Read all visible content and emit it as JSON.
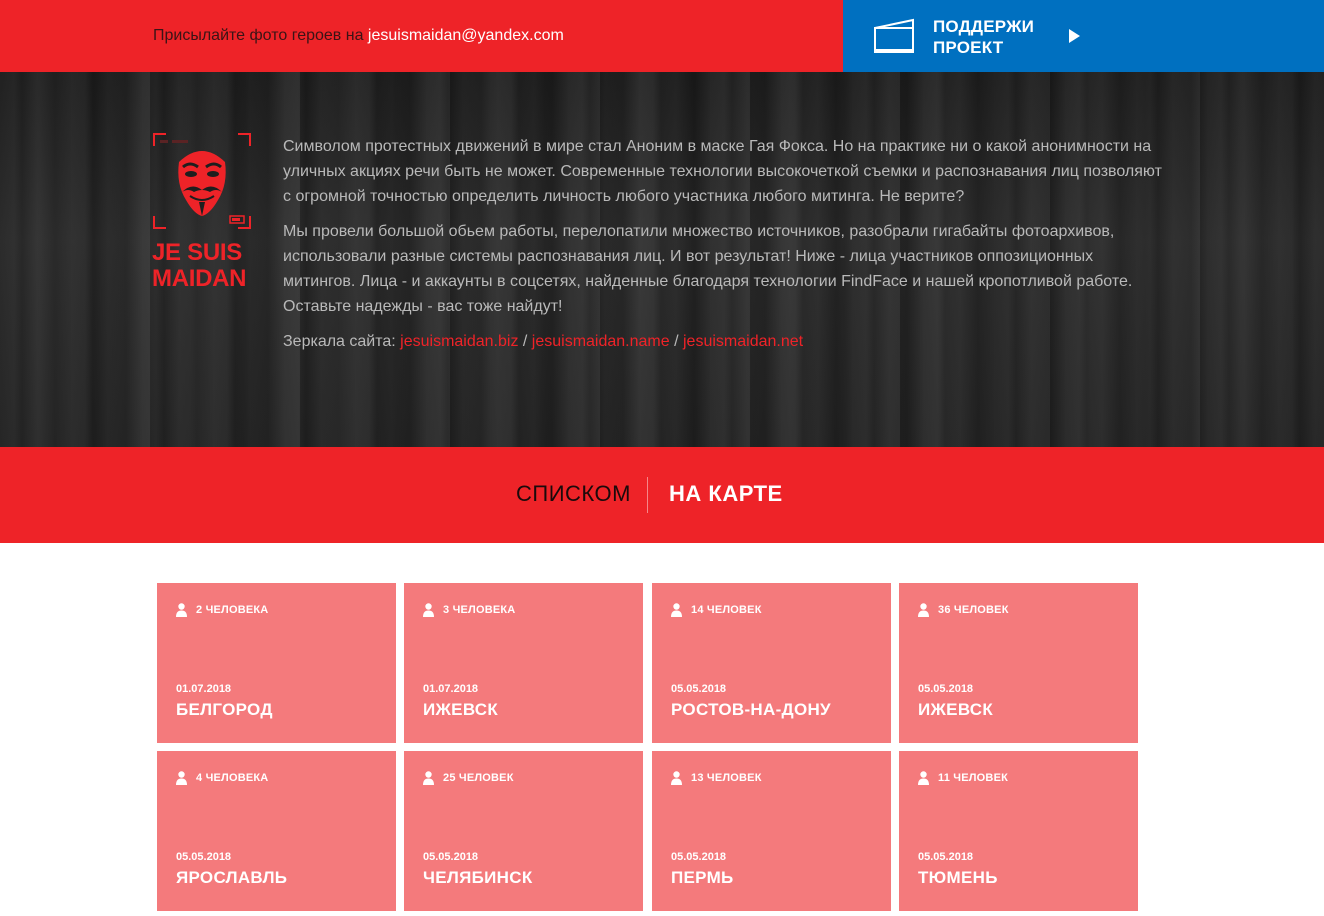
{
  "topbar": {
    "send_text": "Присылайте фото героев на ",
    "send_email": "jesuismaidan@yandex.com",
    "support_line1": "ПОДДЕРЖИ",
    "support_line2": "ПРОЕКТ"
  },
  "logo": {
    "line1": "JE SUIS",
    "line2": "MAIDAN"
  },
  "intro": {
    "paragraph1": "Символом протестных движений в мире стал Аноним в маске Гая Фокса. Но на практике ни о какой анонимности на уличных акциях речи быть не может. Современные технологии высокочеткой съемки и распознавания лиц позволяют с огромной точностью определить личность любого участника любого митинга. Не верите?",
    "paragraph2": "Мы провели большой обьем работы, перелопатили множество источников, разобрали гигабайты фотоархивов, использовали разные системы распознавания лиц. И вот результат! Ниже - лица участников оппозиционных митингов. Лица - и аккаунты в соцсетях, найденные благодаря технологии FindFace и нашей кропотливой работе.",
    "paragraph3": "Оставьте надежды - вас тоже найдут!",
    "mirrors_label": "Зеркала сайта: ",
    "mirrors": [
      "jesuismaidan.biz",
      "jesuismaidan.name",
      "jesuismaidan.net"
    ],
    "mirror_separator": " / "
  },
  "tabs": {
    "list": "СПИСКОМ",
    "map": "НА КАРТЕ"
  },
  "cards": [
    {
      "count": "2 ЧЕЛОВЕКА",
      "date": "01.07.2018",
      "city": "БЕЛГОРОД"
    },
    {
      "count": "3 ЧЕЛОВЕКА",
      "date": "01.07.2018",
      "city": "ИЖЕВСК"
    },
    {
      "count": "14 ЧЕЛОВЕК",
      "date": "05.05.2018",
      "city": "РОСТОВ-НА-ДОНУ"
    },
    {
      "count": "36 ЧЕЛОВЕК",
      "date": "05.05.2018",
      "city": "ИЖЕВСК"
    },
    {
      "count": "4 ЧЕЛОВЕКА",
      "date": "05.05.2018",
      "city": "ЯРОСЛАВЛЬ"
    },
    {
      "count": "25 ЧЕЛОВЕК",
      "date": "05.05.2018",
      "city": "ЧЕЛЯБИНСК"
    },
    {
      "count": "13 ЧЕЛОВЕК",
      "date": "05.05.2018",
      "city": "ПЕРМЬ"
    },
    {
      "count": "11 ЧЕЛОВЕК",
      "date": "05.05.2018",
      "city": "ТЮМЕНЬ"
    }
  ],
  "colors": {
    "brand_red": "#ee2328",
    "support_blue": "#0070c0",
    "card_pink": "#f47a7c",
    "hero_dark": "#232323"
  },
  "icons": {
    "support": "banknote-icon",
    "support_arrow": "play-arrow-icon",
    "logo": "guy-fawkes-mask-icon",
    "card_count": "person-icon"
  }
}
